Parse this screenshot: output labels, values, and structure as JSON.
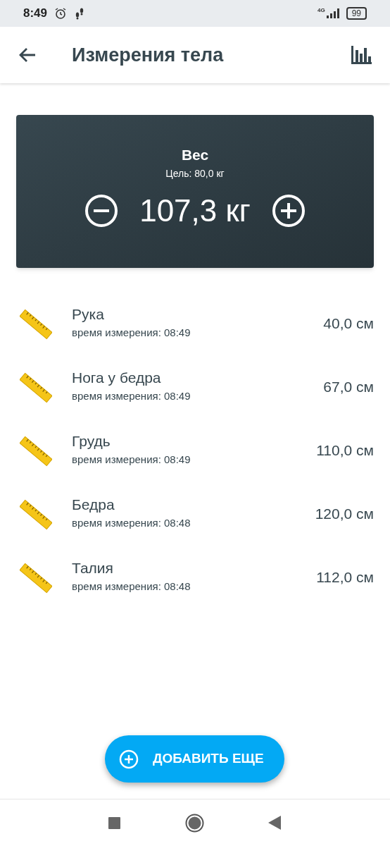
{
  "status_bar": {
    "time": "8:49",
    "network": "4G",
    "battery": "99"
  },
  "app_bar": {
    "title": "Измерения тела"
  },
  "weight_card": {
    "title": "Вес",
    "goal": "Цель: 80,0 кг",
    "value": "107,3 кг"
  },
  "measurements": [
    {
      "name": "Рука",
      "time": "время измерения: 08:49",
      "value": "40,0 см"
    },
    {
      "name": "Нога у бедра",
      "time": "время измерения: 08:49",
      "value": "67,0 см"
    },
    {
      "name": "Грудь",
      "time": "время измерения: 08:49",
      "value": "110,0 см"
    },
    {
      "name": "Бедра",
      "time": "время измерения: 08:48",
      "value": "120,0 см"
    },
    {
      "name": "Талия",
      "time": "время измерения: 08:48",
      "value": "112,0 см"
    }
  ],
  "add_button": {
    "label": "ДОБАВИТЬ ЕЩЕ"
  }
}
